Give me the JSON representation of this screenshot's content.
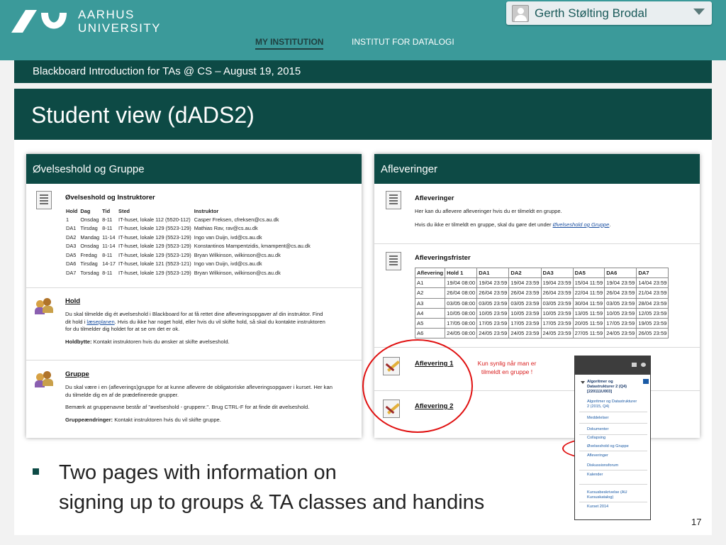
{
  "header": {
    "logo_line1": "AARHUS",
    "logo_line2": "UNIVERSITY",
    "user_name": "Gerth Stølting Brodal",
    "tabs": [
      {
        "label": "MY INSTITUTION",
        "active": true
      },
      {
        "label": "INSTITUT FOR DATALOGI",
        "active": false
      }
    ]
  },
  "course": {
    "title": "Blackboard Introduction for TAs @ CS – August 19, 2015"
  },
  "slide": {
    "title": "Student view (dADS2)",
    "bullet_line1": "Two pages with information on",
    "bullet_line2": "signing up to groups & TA classes and handins",
    "page_number": "17"
  },
  "left_panel": {
    "header": "Øvelseshold og Gruppe",
    "section1_title": "Øvelseshold og Instruktorer",
    "ta_table": {
      "headers": [
        "Hold",
        "Dag",
        "Tid",
        "Sted",
        "Instruktor"
      ],
      "rows": [
        [
          "1",
          "Onsdag",
          "8-11",
          "IT-huset, lokale 112 (5520-112)",
          "Casper Freksen, cfreksen@cs.au.dk"
        ],
        [
          "DA1",
          "Tirsdag",
          "8-11",
          "IT-huset, lokale 129 (5523-129)",
          "Mathias Rav, rav@cs.au.dk"
        ],
        [
          "DA2",
          "Mandag",
          "11-14",
          "IT-huset, lokale 129 (5523-129)",
          "Ingo van Duijn, ivd@cs.au.dk"
        ],
        [
          "DA3",
          "Onsdag",
          "11-14",
          "IT-huset, lokale 129 (5523-129)",
          "Konstantinos Mampentzidis, kmampent@cs.au.dk"
        ],
        [
          "DA5",
          "Fredag",
          "8-11",
          "IT-huset, lokale 129 (5523-129)",
          "Bryan Wilkinson, wilkinson@cs.au.dk"
        ],
        [
          "DA6",
          "Tirsdag",
          "14-17",
          "IT-huset, lokale 121 (5523-121)",
          "Ingo van Duijn, ivd@cs.au.dk"
        ],
        [
          "DA7",
          "Torsdag",
          "8-11",
          "IT-huset, lokale 129 (5523-129)",
          "Bryan Wilkinson, wilkinson@cs.au.dk"
        ]
      ]
    },
    "hold_title": "Hold",
    "hold_text1": "Du skal tilmelde dig ét øvelseshold i Blackboard for at få rettet dine afleveringsopgaver af din instruktor. Find",
    "hold_text2_pre": "dit hold i ",
    "hold_text2_link": "læseplanen",
    "hold_text2_post": ". Hvis du ikke har noget hold, eller hvis du vil skifte hold, så skal du kontakte instruktoren",
    "hold_text3": "for du tilmelder dig holdet for at se om det er ok.",
    "hold_change_label": "Holdbytte:",
    "hold_change_text": " Kontakt instruktoren hvis du ønsker at skifte øvelseshold.",
    "gruppe_title": "Gruppe",
    "gruppe_text1": "Du skal være i en (afleverings)gruppe for at kunne aflevere de obligatoriske afleveringsopgaver i kurset. Her kan",
    "gruppe_text2": "du tilmelde dig en af de prædefinerede grupper.",
    "gruppe_text3": "Bemærk at gruppenavne består af \"øvelseshold - gruppenr.\". Brug CTRL-F for at finde dit øvelseshold.",
    "gruppe_change_label": "Gruppeændringer:",
    "gruppe_change_text": " Kontakt instruktoren hvis du vil skifte gruppe."
  },
  "right_panel": {
    "header": "Afleveringer",
    "section1_title": "Afleveringer",
    "section1_text1": "Her kan du aflevere afleveringer hvis du er tilmeldt en gruppe.",
    "section1_text2_pre": "Hvis du ikke er tilmeldt en gruppe, skal du gøre det under ",
    "section1_text2_link": "Øvelseshold og Gruppe",
    "section1_text2_post": ".",
    "section2_title": "Afleveringsfrister",
    "deadline_table": {
      "headers": [
        "Aflevering",
        "Hold 1",
        "DA1",
        "DA2",
        "DA3",
        "DA5",
        "DA6",
        "DA7"
      ],
      "rows": [
        [
          "A1",
          "19/04 08:00",
          "19/04 23:59",
          "19/04 23:59",
          "19/04 23:59",
          "15/04 11:59",
          "19/04 23:59",
          "14/04 23:59"
        ],
        [
          "A2",
          "26/04 08:00",
          "26/04 23:59",
          "26/04 23:59",
          "26/04 23:59",
          "22/04 11:59",
          "26/04 23:59",
          "21/04 23:59"
        ],
        [
          "A3",
          "03/05 08:00",
          "03/05 23:59",
          "03/05 23:59",
          "03/05 23:59",
          "30/04 11:59",
          "03/05 23:59",
          "28/04 23:59"
        ],
        [
          "A4",
          "10/05 08:00",
          "10/05 23:59",
          "10/05 23:59",
          "10/05 23:59",
          "13/05 11:59",
          "10/05 23:59",
          "12/05 23:59"
        ],
        [
          "A5",
          "17/05 08:00",
          "17/05 23:59",
          "17/05 23:59",
          "17/05 23:59",
          "20/05 11:59",
          "17/05 23:59",
          "19/05 23:59"
        ],
        [
          "A6",
          "24/05 08:00",
          "24/05 23:59",
          "24/05 23:59",
          "24/05 23:59",
          "27/05 11:59",
          "24/05 23:59",
          "26/05 23:59"
        ]
      ]
    },
    "handin1": "Aflevering 1",
    "handin2": "Aflevering 2",
    "note": "Kun synlig når man er tilmeldt en gruppe !"
  },
  "course_menu": {
    "course_name_line1": "Algoritmer og",
    "course_name_line2": "Datastrukturer 2 (Q4)",
    "course_name_line3": "[220111U003]",
    "items": [
      "Algoritmer og Datastrukturer",
      "2 (2015, Q4)",
      "Meddelelser",
      "Dokumenter",
      "Collapsing",
      "Øvelseshold og Gruppe",
      "Afleveringer",
      "Diskussionsforum",
      "Kalender",
      "Kursusbeskrivelse (AU",
      "Kursuskatalog)",
      "Kurset 2014"
    ]
  },
  "colors": {
    "teal_header": "#3b9a9a",
    "dark_teal": "#0d4a45",
    "annotation_red": "#e01010"
  }
}
